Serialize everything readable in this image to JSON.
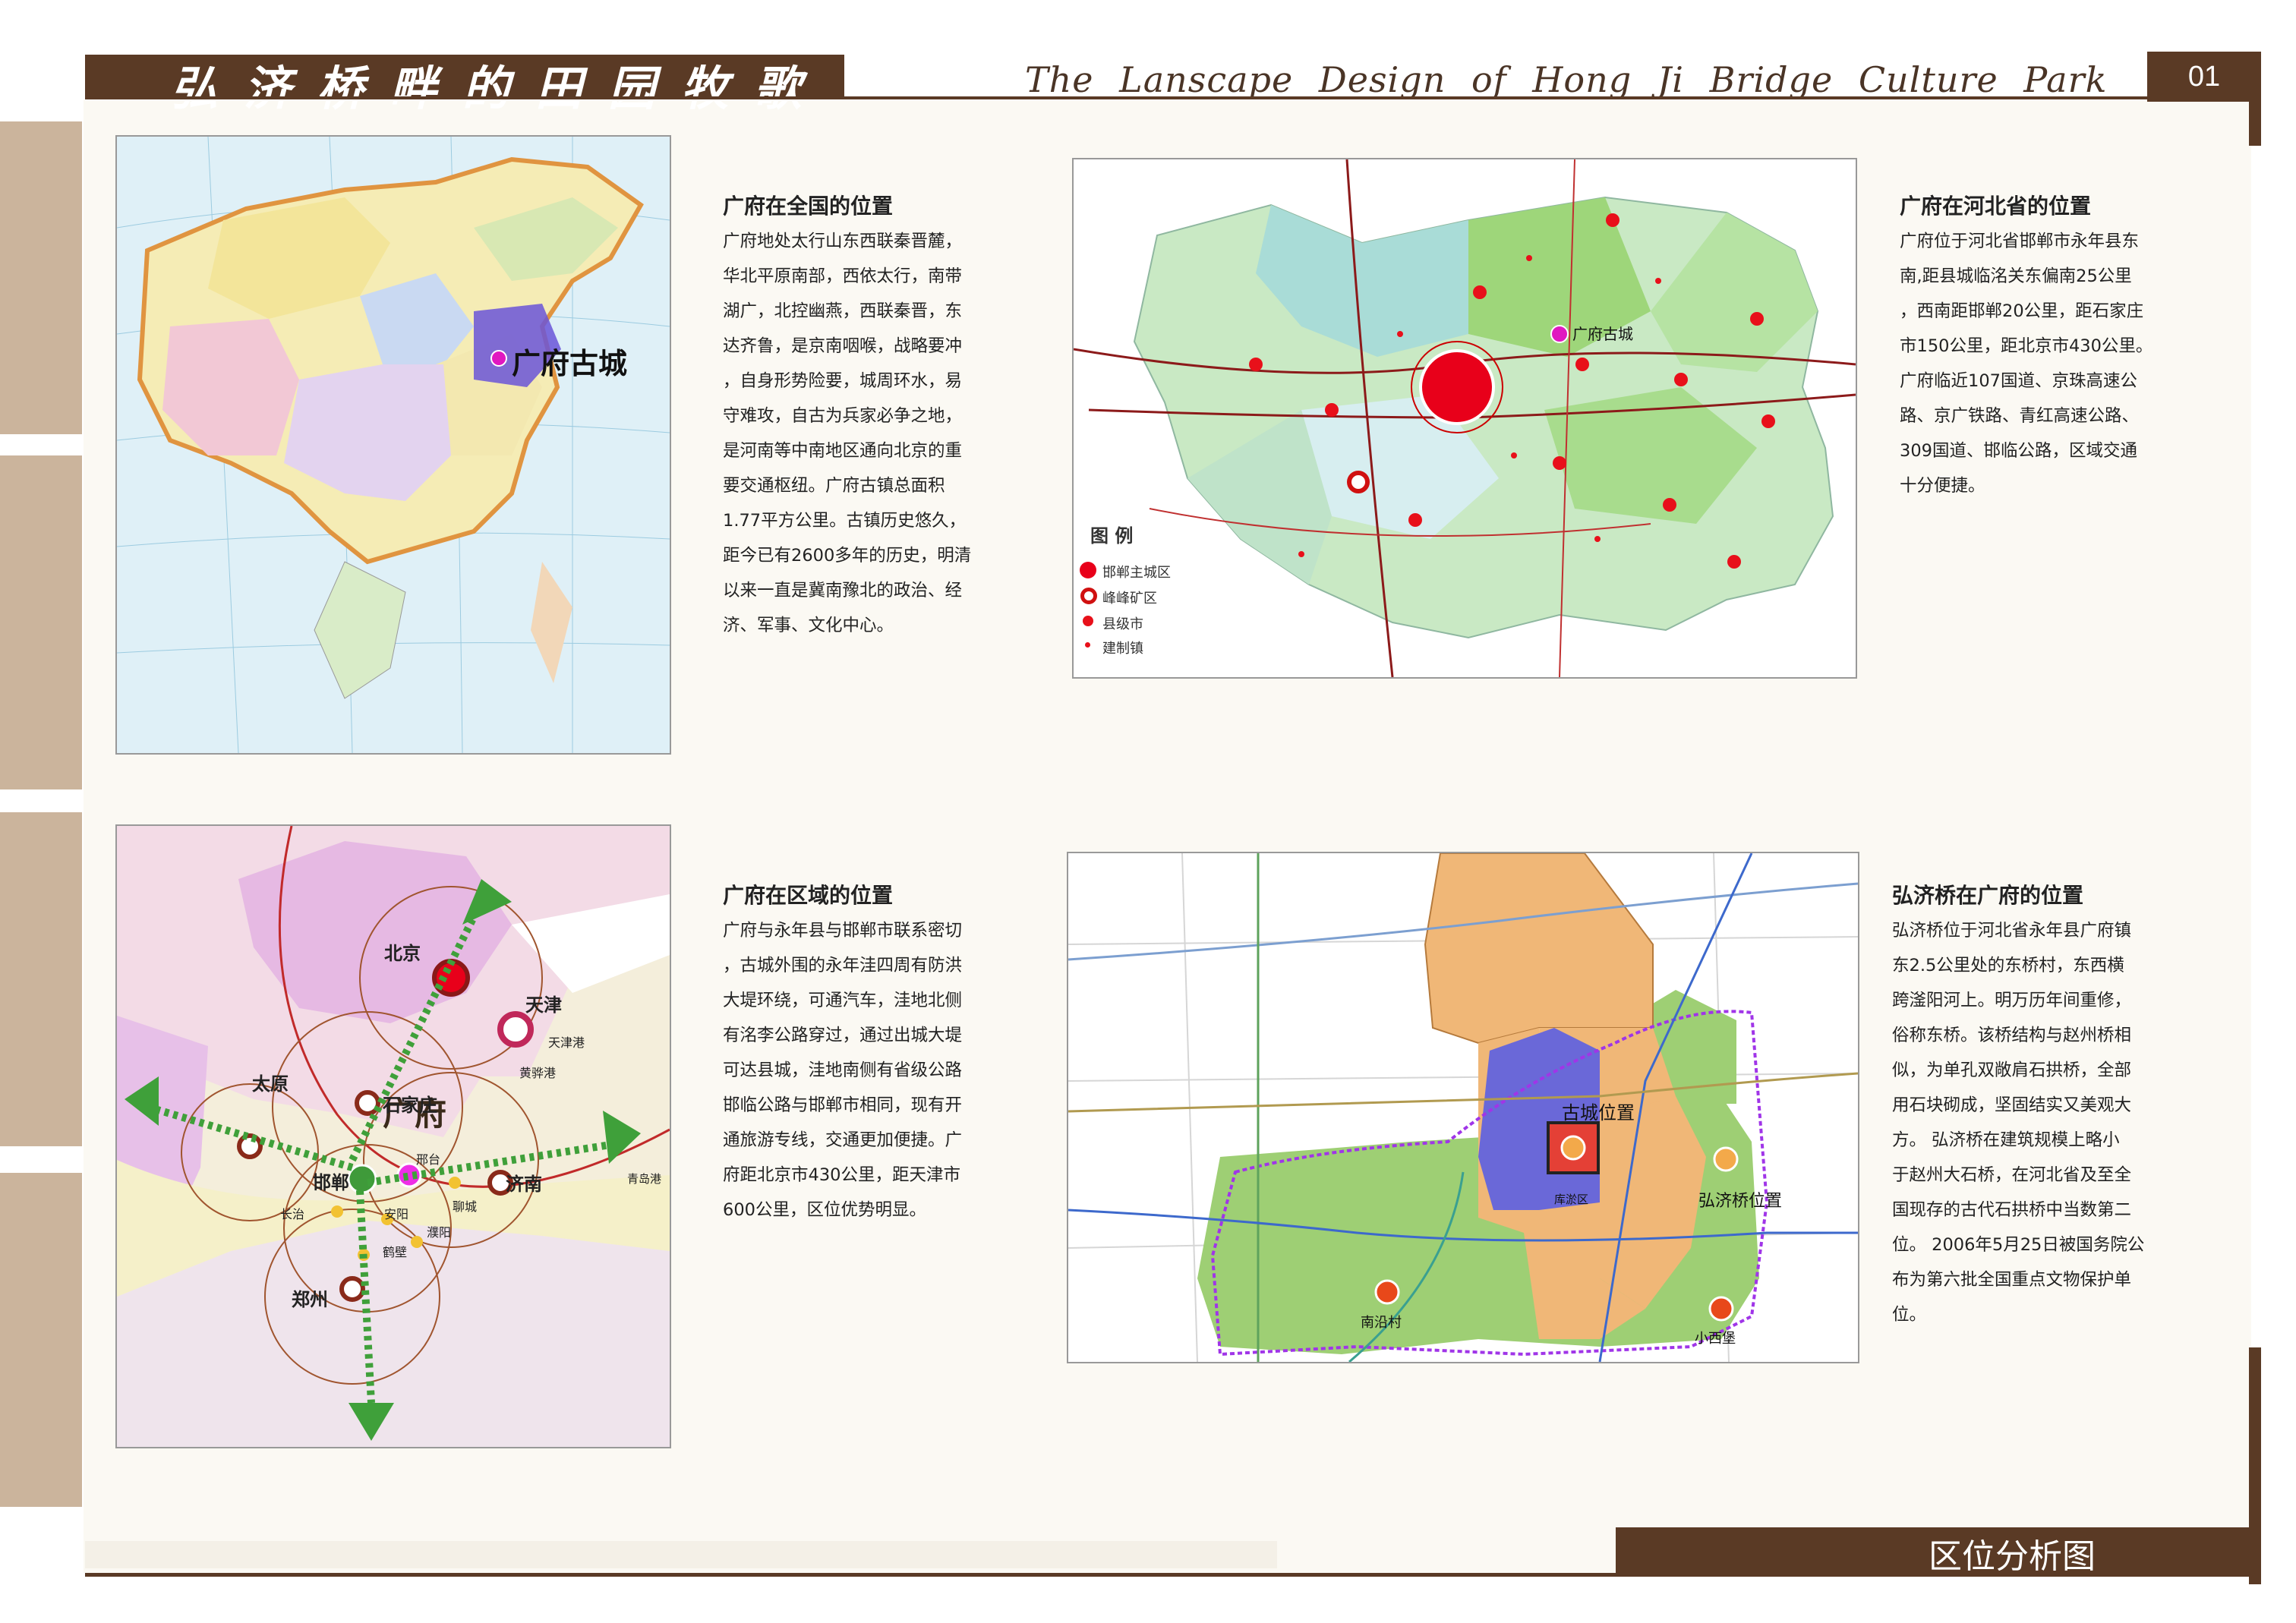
{
  "header": {
    "title_cn": "弘济桥畔的田园牧歌",
    "title_en": "The Lanscape Design of Hong Ji Bridge Culture Park",
    "page_number": "01"
  },
  "footer": {
    "section_title": "区位分析图"
  },
  "colors": {
    "brown": "#5a3a25",
    "tab": "#cbb49c",
    "panel": "#fbf9f3"
  },
  "sections": [
    {
      "title": "广府在全国的位置",
      "lines": [
        "广府地处太行山东西联秦晋麓，",
        "华北平原南部，西依太行，南带",
        "湖广，北控幽燕，西联秦晋，东",
        "达齐鲁，是京南咽喉，战略要冲",
        "，自身形势险要，城周环水，易",
        "守难攻，自古为兵家必争之地，",
        "是河南等中南地区通向北京的重",
        "要交通枢纽。广府古镇总面积",
        "1.77平方公里。古镇历史悠久，",
        "距今已有2600多年的历史，明清",
        "以来一直是冀南豫北的政治、经",
        "济、军事、文化中心。"
      ]
    },
    {
      "title": "广府在河北省的位置",
      "lines": [
        "广府位于河北省邯郸市永年县东",
        "南,距县城临洺关东偏南25公里",
        "，西南距邯郸20公里，距石家庄",
        "市150公里，距北京市430公里。",
        "广府临近107国道、京珠高速公",
        "路、京广铁路、青红高速公路、",
        "309国道、邯临公路，区域交通",
        "十分便捷。"
      ]
    },
    {
      "title": "广府在区域的位置",
      "lines": [
        "广府与永年县与邯郸市联系密切",
        "，古城外围的永年洼四周有防洪",
        "大堤环绕，可通汽车，洼地北侧",
        "有洺李公路穿过，通过出城大堤",
        "可达县城，洼地南侧有省级公路",
        "邯临公路与邯郸市相同，现有开",
        "通旅游专线，交通更加便捷。广",
        "府距北京市430公里，距天津市",
        "600公里，区位优势明显。"
      ]
    },
    {
      "title": "弘济桥在广府的位置",
      "lines": [
        "弘济桥位于河北省永年县广府镇",
        "东2.5公里处的东桥村，东西横",
        "跨滏阳河上。明万历年间重修，",
        "俗称东桥。该桥结构与赵州桥相",
        "似，为单孔双敞肩石拱桥，全部",
        "用石块砌成，坚固结实又美观大",
        "方。 弘济桥在建筑规模上略小",
        "于赵州大石桥，在河北省及至全",
        "国现存的古代石拱桥中当数第二",
        "位。 2006年5月25日被国务院公",
        "布为第六批全国重点文物保护单",
        "位。"
      ]
    }
  ],
  "maps": {
    "china": {
      "marker_label": "广府古城"
    },
    "hebei": {
      "marker_label": "广府古城",
      "legend_title": "图  例",
      "legend": [
        "邯郸主城区",
        "峰峰矿区",
        "县级市",
        "建制镇"
      ]
    },
    "region": {
      "center_label": "广府",
      "cities": [
        "北京",
        "天津",
        "天津港",
        "太原",
        "石家庄",
        "黄骅港",
        "邢台",
        "邯郸",
        "济南",
        "青岛港",
        "长治",
        "安阳",
        "聊城",
        "濮阳",
        "鹤壁",
        "郑州"
      ]
    },
    "local": {
      "labels": [
        "古城位置",
        "弘济桥位置",
        "南沿村",
        "小西堡",
        "库淤区"
      ]
    }
  }
}
